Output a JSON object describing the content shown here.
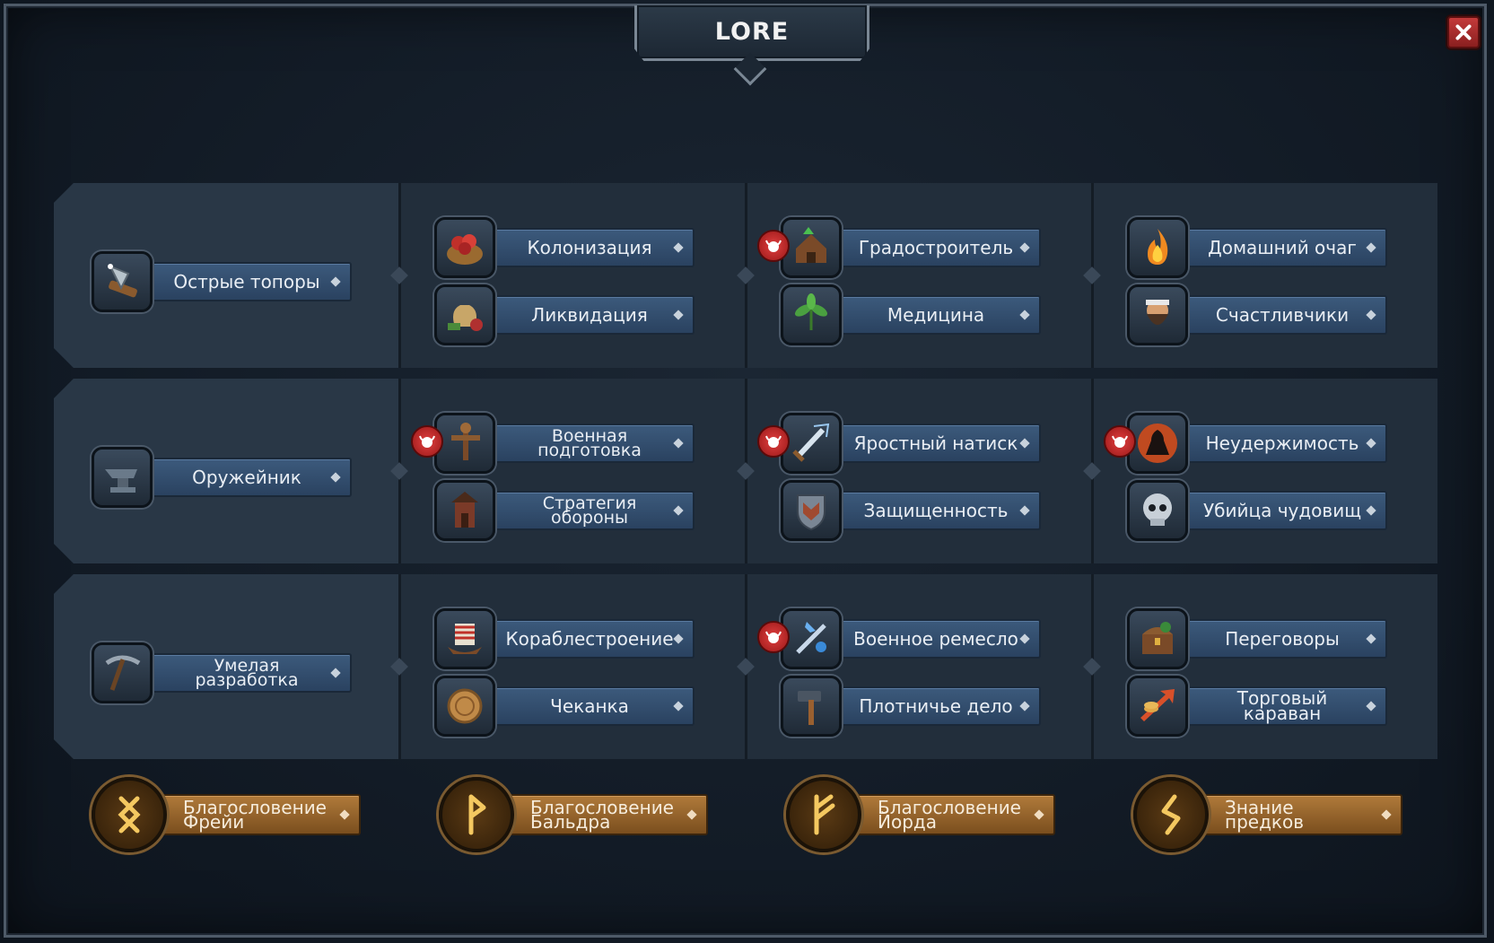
{
  "window": {
    "title": "LORE",
    "close_icon": "close-icon"
  },
  "rows": [
    {
      "main": {
        "label": "Острые топоры",
        "icon": "axe-icon"
      },
      "columns": [
        [
          {
            "label": "Колонизация",
            "icon": "harvest-basket-icon",
            "badge": false
          },
          {
            "label": "Ликвидация",
            "icon": "loot-sack-icon",
            "badge": false
          }
        ],
        [
          {
            "label": "Градостроитель",
            "icon": "house-upgrade-icon",
            "badge": true
          },
          {
            "label": "Медицина",
            "icon": "herb-icon",
            "badge": false
          }
        ],
        [
          {
            "label": "Домашний очаг",
            "icon": "fire-icon",
            "badge": false
          },
          {
            "label": "Счастливчики",
            "icon": "viking-face-icon",
            "badge": false
          }
        ]
      ]
    },
    {
      "main": {
        "label": "Оружейник",
        "icon": "anvil-icon"
      },
      "columns": [
        [
          {
            "label": "Военная подготовка",
            "icon": "training-dummy-icon",
            "badge": true
          },
          {
            "label": "Стратегия обороны",
            "icon": "watchtower-icon",
            "badge": false
          }
        ],
        [
          {
            "label": "Яростный натиск",
            "icon": "sword-strike-icon",
            "badge": true
          },
          {
            "label": "Защищенность",
            "icon": "shield-icon",
            "badge": false
          }
        ],
        [
          {
            "label": "Неудержимость",
            "icon": "rage-warrior-icon",
            "badge": true
          },
          {
            "label": "Убийца чудовищ",
            "icon": "monster-skull-icon",
            "badge": false
          }
        ]
      ]
    },
    {
      "main": {
        "label": "Умелая разработка",
        "icon": "pickaxe-icon"
      },
      "columns": [
        [
          {
            "label": "Кораблестроение",
            "icon": "longship-icon",
            "badge": false
          },
          {
            "label": "Чеканка",
            "icon": "coin-icon",
            "badge": false
          }
        ],
        [
          {
            "label": "Военное ремесло",
            "icon": "weapon-craft-icon",
            "badge": true
          },
          {
            "label": "Плотничье дело",
            "icon": "hammer-icon",
            "badge": false
          }
        ],
        [
          {
            "label": "Переговоры",
            "icon": "treasure-chest-icon",
            "badge": false
          },
          {
            "label": "Торговый караван",
            "icon": "trade-arrow-icon",
            "badge": false
          }
        ]
      ]
    }
  ],
  "blessings": [
    {
      "label": "Благословение Фрейи",
      "icon": "rune-othala-icon"
    },
    {
      "label": "Благословение Бальдра",
      "icon": "rune-wunjo-icon"
    },
    {
      "label": "Благословение Йорда",
      "icon": "rune-fehu-icon"
    },
    {
      "label": "Знание предков",
      "icon": "rune-sowilo-icon"
    }
  ],
  "badge_icon": "bull-head-icon",
  "colors": {
    "badge": "#c62c2c",
    "skill_label": "#2f4a6a",
    "blessing_label": "#9a6630",
    "panel": "#222e3b"
  }
}
